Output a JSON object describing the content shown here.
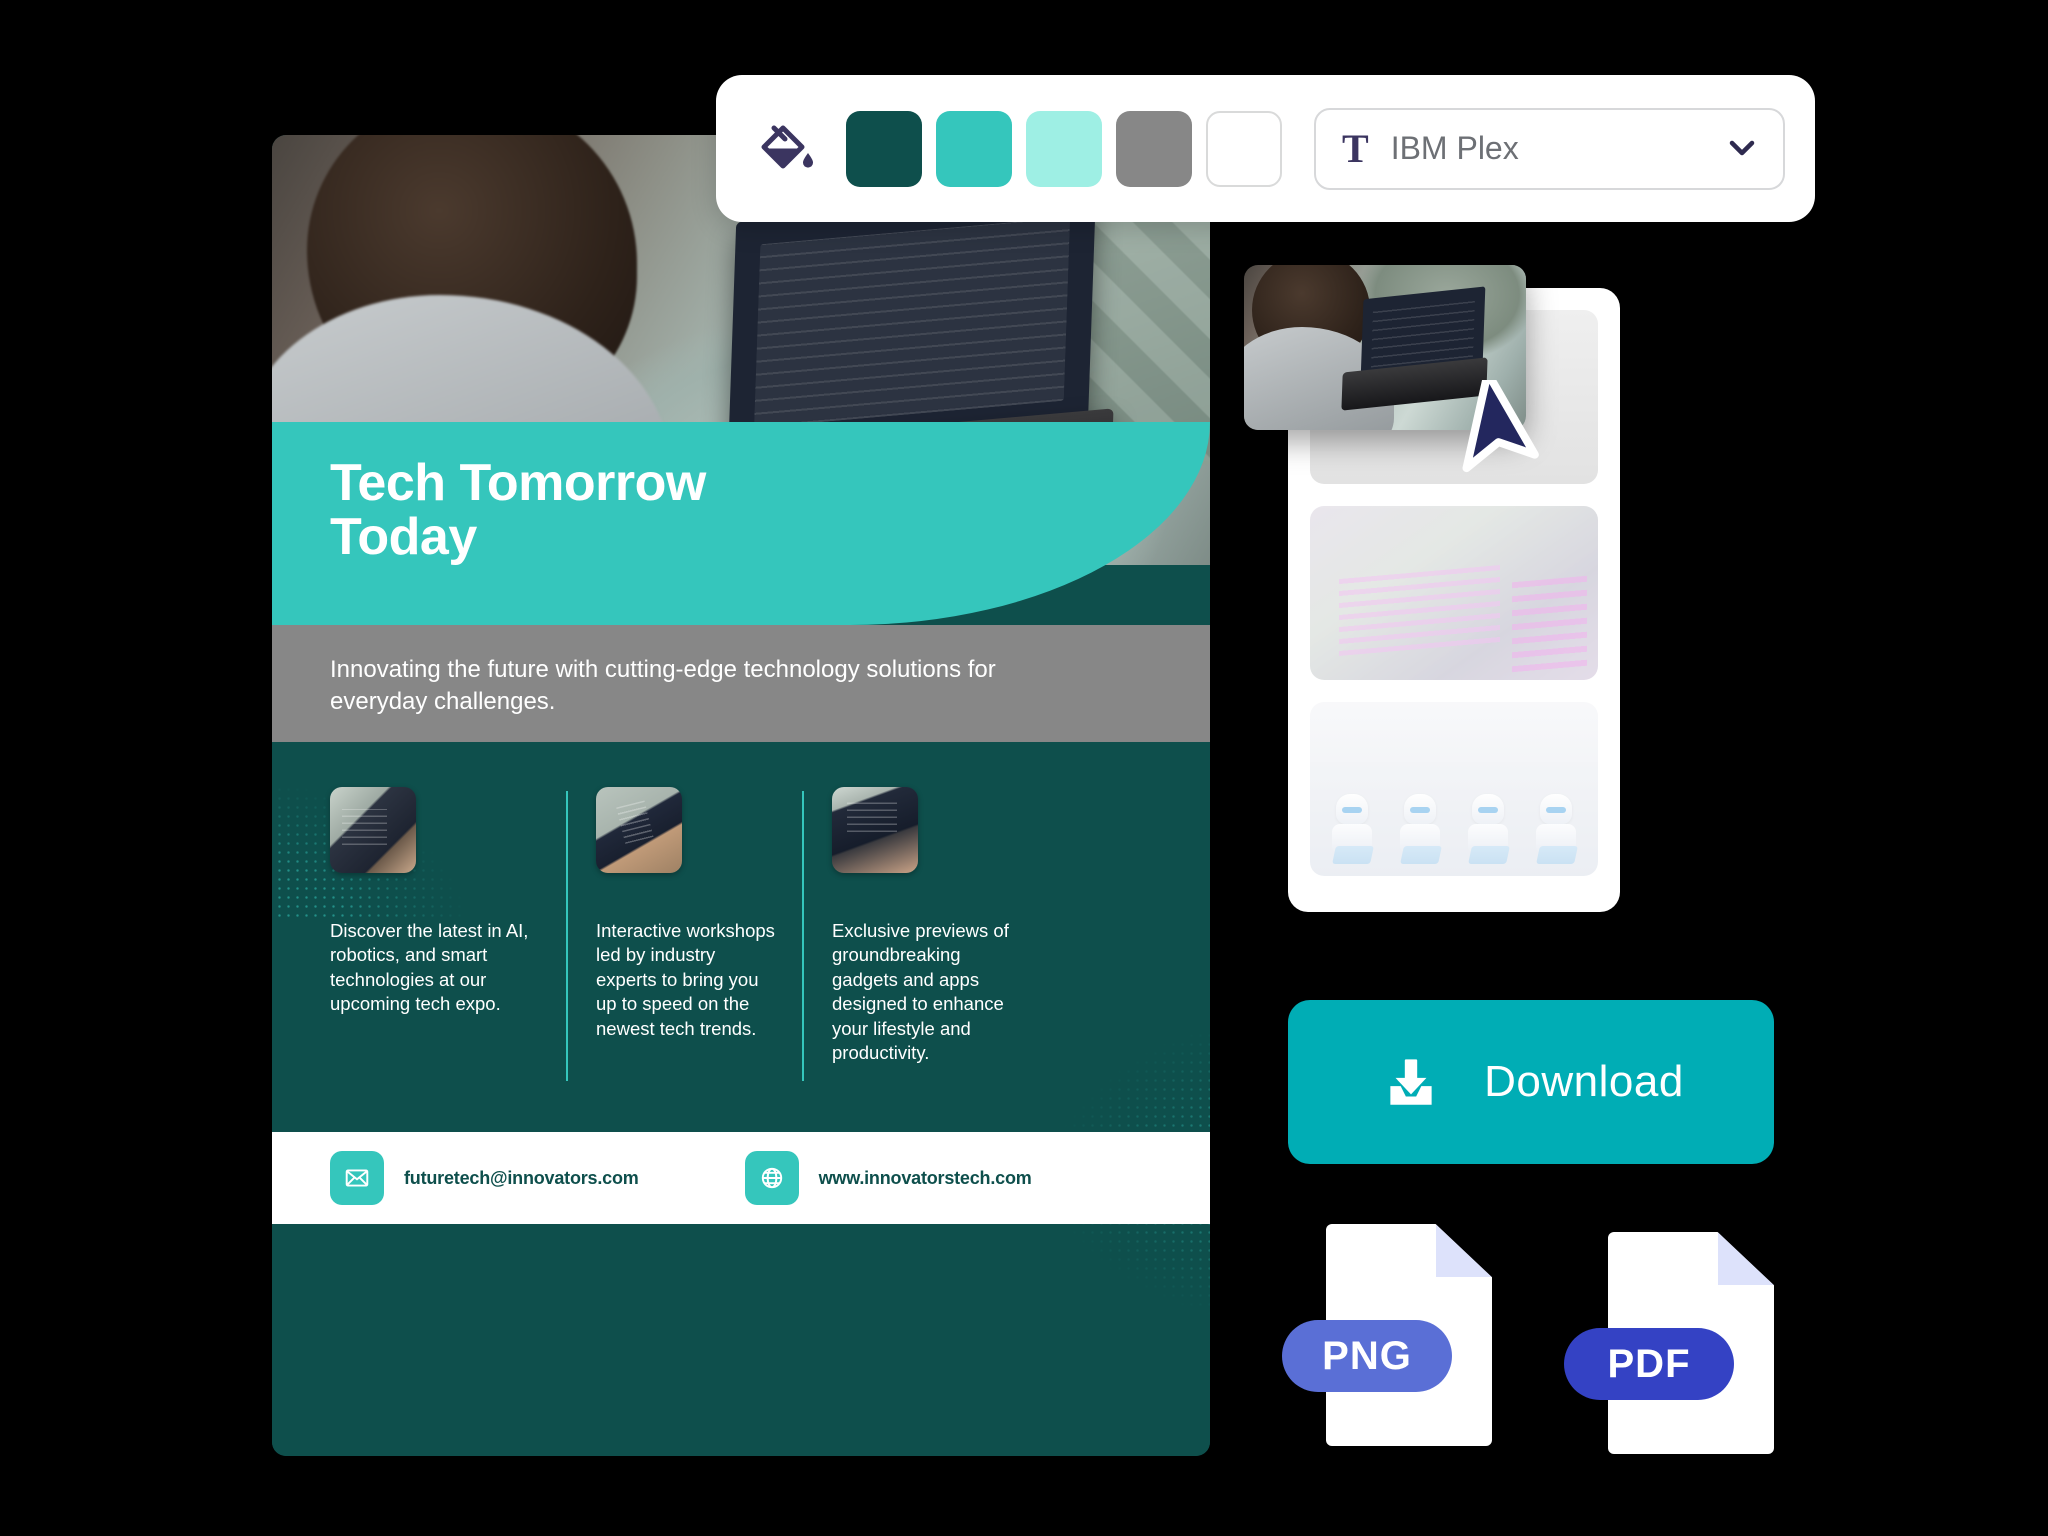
{
  "toolbar": {
    "fill_icon": "paint-bucket-icon",
    "swatches": [
      {
        "name": "swatch-dark-teal",
        "color": "#0E4F4C"
      },
      {
        "name": "swatch-teal",
        "color": "#35C6BC"
      },
      {
        "name": "swatch-mint",
        "color": "#9EEFE4"
      },
      {
        "name": "swatch-gray",
        "color": "#878787"
      },
      {
        "name": "swatch-white",
        "color": "#FFFFFF"
      }
    ],
    "font_select": {
      "glyph": "T",
      "value": "IBM Plex",
      "chevron": "⌄"
    }
  },
  "poster": {
    "title": "Tech Tomorrow\nToday",
    "title_line1": "Tech Tomorrow",
    "title_line2": "Today",
    "subtitle": "Innovating the future with cutting-edge technology solutions for everyday challenges.",
    "columns": [
      {
        "text": "Discover the latest in AI, robotics, and smart technologies at our upcoming tech expo."
      },
      {
        "text": "Interactive workshops led by industry experts to bring you up to speed on the newest tech trends."
      },
      {
        "text": "Exclusive previews of groundbreaking gadgets and apps designed to enhance your lifestyle and productivity."
      }
    ],
    "contact": {
      "email": "futuretech@innovators.com",
      "website": "www.innovatorstech.com",
      "email_icon": "envelope-icon",
      "website_icon": "globe-icon"
    },
    "colors": {
      "band": "#35C6BC",
      "subtitle_bar": "#878787",
      "body": "#0E4F4C",
      "accent": "#35C6BC"
    }
  },
  "panel": {
    "cards": [
      {
        "name": "thumbnail-card-1",
        "label": "person-with-laptop-photo"
      },
      {
        "name": "thumbnail-card-2",
        "label": "chatgpt-article-photo"
      },
      {
        "name": "thumbnail-card-3",
        "label": "robots-with-laptops-photo"
      }
    ]
  },
  "dragging": {
    "thumbnail": "person-with-laptop-photo",
    "cursor": "arrow-cursor"
  },
  "download": {
    "label": "Download",
    "icon": "download-tray-icon",
    "color": "#00ADB5"
  },
  "file_formats": [
    {
      "label": "PNG",
      "color": "#5A6FD6",
      "fold_color": "#DDE2FB"
    },
    {
      "label": "PDF",
      "color": "#3442C4",
      "fold_color": "#DDE2FB"
    }
  ]
}
